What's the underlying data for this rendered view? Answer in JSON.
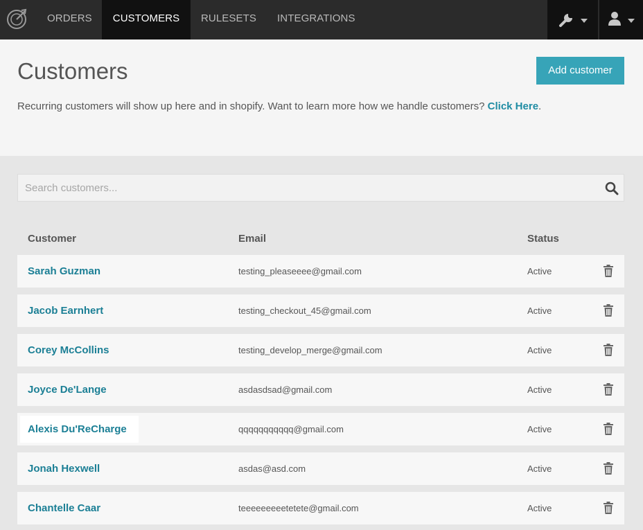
{
  "nav": {
    "items": [
      {
        "label": "ORDERS"
      },
      {
        "label": "CUSTOMERS"
      },
      {
        "label": "RULESETS"
      },
      {
        "label": "INTEGRATIONS"
      }
    ],
    "active": "CUSTOMERS",
    "right_icons": [
      "wrench-icon",
      "user-icon"
    ]
  },
  "header": {
    "title": "Customers",
    "add_button": "Add customer",
    "intro_text": "Recurring customers will show up here and in shopify. Want to learn more how we handle customers? ",
    "intro_link": "Click Here",
    "intro_end": "."
  },
  "search": {
    "placeholder": "Search customers..."
  },
  "table": {
    "columns": [
      "Customer",
      "Email",
      "Status"
    ],
    "rows": [
      {
        "name": "Sarah Guzman",
        "email": "testing_pleaseeee@gmail.com",
        "status": "Active"
      },
      {
        "name": "Jacob Earnhert",
        "email": "testing_checkout_45@gmail.com",
        "status": "Active"
      },
      {
        "name": "Corey McCollins",
        "email": "testing_develop_merge@gmail.com",
        "status": "Active"
      },
      {
        "name": "Joyce De'Lange",
        "email": "asdasdsad@gmail.com",
        "status": "Active"
      },
      {
        "name": "Alexis Du'ReCharge",
        "email": "qqqqqqqqqqq@gmail.com",
        "status": "Active"
      },
      {
        "name": "Jonah Hexwell",
        "email": "asdas@asd.com",
        "status": "Active"
      },
      {
        "name": "Chantelle Caar",
        "email": "teeeeeeeeetetete@gmail.com",
        "status": "Active"
      }
    ]
  },
  "colors": {
    "navbar": "#2b2b2b",
    "accent": "#37a4b8",
    "link": "#1b7f95"
  }
}
